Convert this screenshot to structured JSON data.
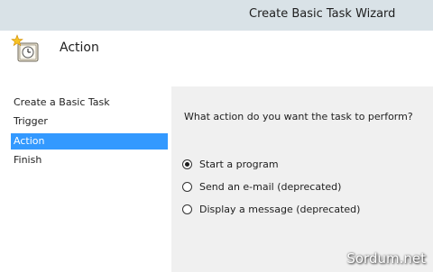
{
  "window": {
    "title": "Create Basic Task Wizard",
    "background_title_fragment": "wizard icon partially hidden text"
  },
  "header": {
    "title": "Action",
    "icon": "clock-with-star-icon"
  },
  "sidebar": {
    "items": [
      {
        "label": "Create a Basic Task",
        "selected": false
      },
      {
        "label": "Trigger",
        "selected": false
      },
      {
        "label": "Action",
        "selected": true
      },
      {
        "label": "Finish",
        "selected": false
      }
    ]
  },
  "content": {
    "question": "What action do you want the task to perform?",
    "options": [
      {
        "label": "Start a program",
        "checked": true
      },
      {
        "label": "Send an e-mail (deprecated)",
        "checked": false
      },
      {
        "label": "Display a message (deprecated)",
        "checked": false
      }
    ]
  },
  "watermark": "Sordum.net",
  "colors": {
    "selection": "#3399ff",
    "titlebar": "#d9e2e7",
    "panel": "#f0f0f0"
  }
}
